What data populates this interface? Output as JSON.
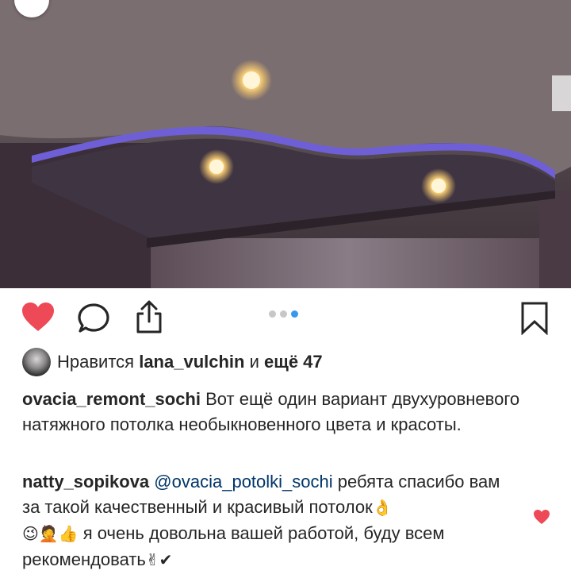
{
  "post": {
    "likes": {
      "prefix": "Нравится",
      "user": "lana_vulchin",
      "middle": "и",
      "more": "ещё 47"
    },
    "caption": {
      "username": "ovacia_remont_sochi",
      "text": "Вот ещё один вариант двухуровневого натяжного потолка необыкновенного цвета и красоты."
    },
    "carousel": {
      "total": 3,
      "active_index": 3
    }
  },
  "comment": {
    "username": "natty_sopikova",
    "mention": "@ovacia_potolki_sochi",
    "text_part1": "ребята спасибо вам за такой качественный и красивый потолок",
    "emoji_ok": "👌",
    "emoji_row": "😉🤦👍",
    "text_part2": "я очень довольна вашей работой, буду всем рекомендовать",
    "emoji_end": "✌✔"
  },
  "icons": {
    "like": "heart-icon-filled",
    "comment": "comment-bubble-icon",
    "share": "share-upload-icon",
    "save": "bookmark-icon",
    "back": "chevron-icon"
  },
  "colors": {
    "like": "#ed4956",
    "link": "#003569",
    "dot_active": "#3897f0",
    "dot_inactive": "#c7c7c7"
  }
}
